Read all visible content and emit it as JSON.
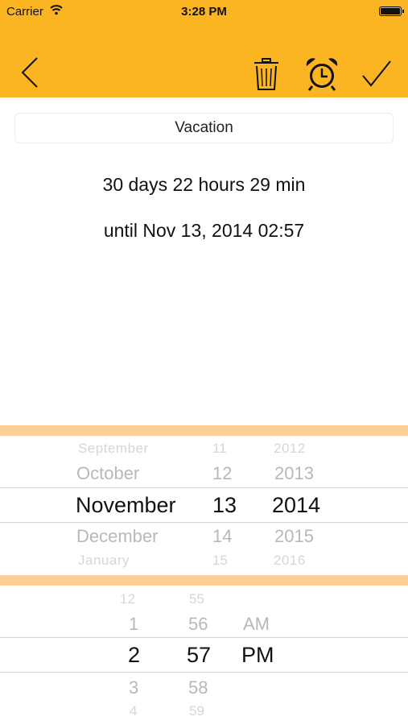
{
  "status_bar": {
    "carrier": "Carrier",
    "time": "3:28 PM"
  },
  "name_field": {
    "value": "Vacation"
  },
  "countdown": {
    "duration": "30 days 22 hours 29 min",
    "until": "until Nov 13, 2014 02:57"
  },
  "date_picker": {
    "months": [
      "September",
      "October",
      "November",
      "December",
      "January"
    ],
    "days": [
      "11",
      "12",
      "13",
      "14",
      "15"
    ],
    "years": [
      "2012",
      "2013",
      "2014",
      "2015",
      "2016"
    ]
  },
  "time_picker": {
    "hours": [
      "12",
      "1",
      "2",
      "3",
      "4"
    ],
    "minutes": [
      "55",
      "56",
      "57",
      "58",
      "59"
    ],
    "ampm": [
      "AM",
      "PM"
    ]
  },
  "colors": {
    "accent": "#fbb522",
    "separator": "#fdcf97"
  }
}
